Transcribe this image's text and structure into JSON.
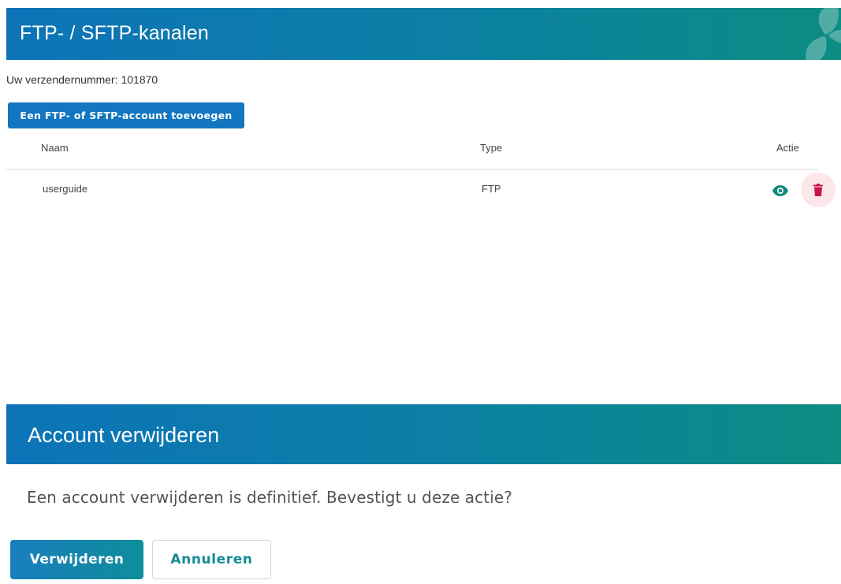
{
  "channels_panel": {
    "title": "FTP- / SFTP-kanalen",
    "sender_number_text": "Uw verzendernummer: 101870",
    "add_button_label": "Een FTP- of SFTP-account toevoegen",
    "table": {
      "headers": {
        "name": "Naam",
        "type": "Type",
        "action": "Actie"
      },
      "rows": [
        {
          "name": "userguide",
          "type": "FTP",
          "actions": [
            "eye-icon",
            "trash-icon"
          ]
        }
      ]
    }
  },
  "delete_dialog": {
    "title": "Account verwijderen",
    "message": "Een account verwijderen is definitief. Bevestigt u deze actie?",
    "confirm_label": "Verwijderen",
    "cancel_label": "Annuleren"
  },
  "colors": {
    "header_gradient_start": "#0d74b8",
    "header_gradient_end": "#0c8c82",
    "primary_button": "#1276c0",
    "view_icon": "#10897d",
    "delete_icon": "#c8144a",
    "delete_icon_bg": "#fbe6ea",
    "cancel_text": "#138b94"
  }
}
